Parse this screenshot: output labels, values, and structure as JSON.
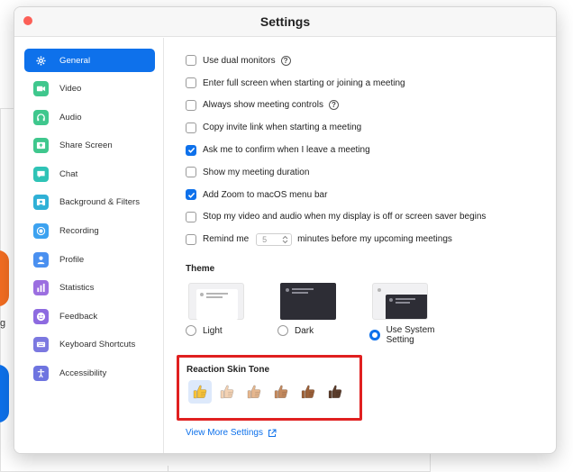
{
  "window": {
    "title": "Settings"
  },
  "background": {
    "letter": "g"
  },
  "sidebar": {
    "items": [
      {
        "label": "General",
        "icon": "gear-icon",
        "color": "#0e71eb",
        "active": true
      },
      {
        "label": "Video",
        "icon": "video-icon",
        "color": "#3fc78d"
      },
      {
        "label": "Audio",
        "icon": "headphones-icon",
        "color": "#3fc78d"
      },
      {
        "label": "Share Screen",
        "icon": "share-screen-icon",
        "color": "#3fc78d"
      },
      {
        "label": "Chat",
        "icon": "chat-icon",
        "color": "#2fc3b6"
      },
      {
        "label": "Background & Filters",
        "icon": "background-icon",
        "color": "#2fb0d6"
      },
      {
        "label": "Recording",
        "icon": "recording-icon",
        "color": "#3ca2f0"
      },
      {
        "label": "Profile",
        "icon": "profile-icon",
        "color": "#4a90f0"
      },
      {
        "label": "Statistics",
        "icon": "statistics-icon",
        "color": "#9b6ee0"
      },
      {
        "label": "Feedback",
        "icon": "feedback-icon",
        "color": "#8d6ae0"
      },
      {
        "label": "Keyboard Shortcuts",
        "icon": "keyboard-icon",
        "color": "#7b78e0"
      },
      {
        "label": "Accessibility",
        "icon": "accessibility-icon",
        "color": "#6e74e0"
      }
    ]
  },
  "general": {
    "options": [
      {
        "label": "Use dual monitors",
        "checked": false,
        "help": true
      },
      {
        "label": "Enter full screen when starting or joining a meeting",
        "checked": false
      },
      {
        "label": "Always show meeting controls",
        "checked": false,
        "help": true
      },
      {
        "label": "Copy invite link when starting a meeting",
        "checked": false
      },
      {
        "label": "Ask me to confirm when I leave a meeting",
        "checked": true
      },
      {
        "label": "Show my meeting duration",
        "checked": false
      },
      {
        "label": "Add Zoom to macOS menu bar",
        "checked": true
      },
      {
        "label": "Stop my video and audio when my display is off or screen saver begins",
        "checked": false
      }
    ],
    "remind": {
      "before": "Remind me",
      "value": "5",
      "after": "minutes before my upcoming meetings",
      "checked": false
    },
    "help_glyph": "?",
    "theme": {
      "title": "Theme",
      "options": [
        {
          "label": "Light",
          "selected": false
        },
        {
          "label": "Dark",
          "selected": false
        },
        {
          "label": "Use System Setting",
          "selected": true
        }
      ]
    },
    "skin_tone": {
      "title": "Reaction Skin Tone",
      "tones": [
        "#f7c23a",
        "#f3d2b4",
        "#e5b78f",
        "#c48a5f",
        "#9c6139",
        "#5c3d2c"
      ],
      "selected_index": 0
    },
    "more_link": "View More Settings"
  },
  "colors": {
    "accent": "#0e71eb",
    "highlight": "#e02020"
  }
}
